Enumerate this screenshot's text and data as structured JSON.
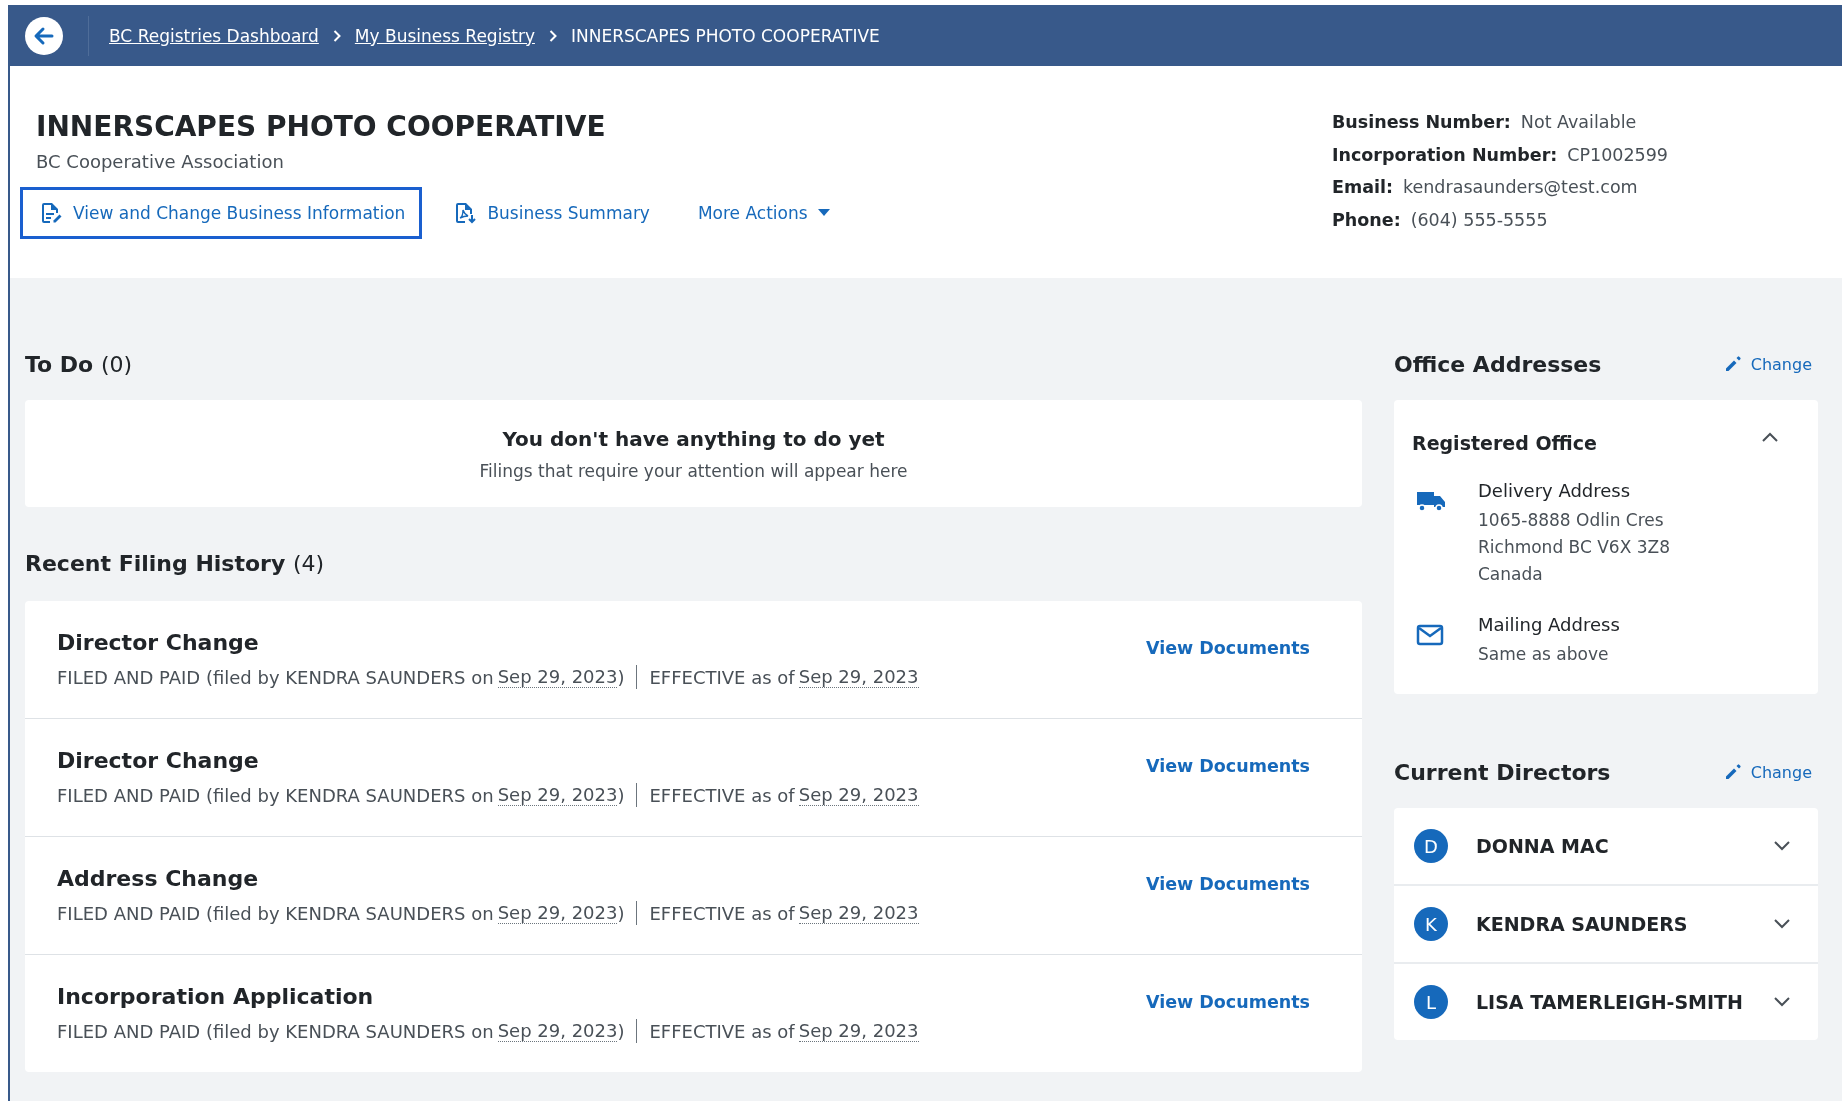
{
  "breadcrumb": [
    {
      "label": "BC Registries Dashboard",
      "kind": "link"
    },
    {
      "label": "My Business Registry",
      "kind": "link"
    },
    {
      "label": "INNERSCAPES PHOTO COOPERATIVE",
      "kind": "current"
    }
  ],
  "business": {
    "name": "INNERSCAPES PHOTO COOPERATIVE",
    "type": "BC Cooperative Association",
    "actions": [
      {
        "label": "View and Change Business Information",
        "kind": "edit",
        "focused": true
      },
      {
        "label": "Business Summary",
        "kind": "pdf",
        "focused": false
      },
      {
        "label": "More Actions",
        "kind": "menu",
        "focused": false
      }
    ],
    "details": [
      {
        "label": "Business Number:",
        "value": "Not Available"
      },
      {
        "label": "Incorporation Number:",
        "value": "CP1002599"
      },
      {
        "label": "Email:",
        "value": "kendrasaunders@test.com"
      },
      {
        "label": "Phone:",
        "value": "(604) 555-5555"
      }
    ]
  },
  "todo": {
    "title": "To Do",
    "count": "(0)",
    "empty_title": "You don't have anything to do yet",
    "empty_text": "Filings that require your attention will appear here"
  },
  "filing_history": {
    "title": "Recent Filing History",
    "count": "(4)",
    "items": [
      {
        "title": "Director Change",
        "status": "FILED AND PAID (filed by KENDRA SAUNDERS on",
        "filed_date": "Sep 29, 2023",
        "close": ")",
        "effective": "EFFECTIVE as of",
        "effective_date": "Sep 29, 2023",
        "action": "View Documents"
      },
      {
        "title": "Director Change",
        "status": "FILED AND PAID (filed by KENDRA SAUNDERS on",
        "filed_date": "Sep 29, 2023",
        "close": ")",
        "effective": "EFFECTIVE as of",
        "effective_date": "Sep 29, 2023",
        "action": "View Documents"
      },
      {
        "title": "Address Change",
        "status": "FILED AND PAID (filed by KENDRA SAUNDERS on",
        "filed_date": "Sep 29, 2023",
        "close": ")",
        "effective": "EFFECTIVE as of",
        "effective_date": "Sep 29, 2023",
        "action": "View Documents"
      },
      {
        "title": "Incorporation Application",
        "status": "FILED AND PAID (filed by KENDRA SAUNDERS on",
        "filed_date": "Sep 29, 2023",
        "close": ")",
        "effective": "EFFECTIVE as of",
        "effective_date": "Sep 29, 2023",
        "action": "View Documents"
      }
    ]
  },
  "office_addresses": {
    "title": "Office Addresses",
    "change": "Change",
    "office": {
      "title": "Registered Office",
      "expanded": true,
      "addresses": [
        {
          "kind": "delivery",
          "label": "Delivery Address",
          "lines": [
            "1065-8888 Odlin Cres",
            "Richmond BC V6X 3Z8",
            "Canada"
          ]
        },
        {
          "kind": "mailing",
          "label": "Mailing Address",
          "lines": [
            "Same as above"
          ]
        }
      ]
    }
  },
  "directors": {
    "title": "Current Directors",
    "change": "Change",
    "items": [
      {
        "initial": "D",
        "name": "DONNA MAC",
        "expanded": false
      },
      {
        "initial": "K",
        "name": "KENDRA SAUNDERS",
        "expanded": false
      },
      {
        "initial": "L",
        "name": "LISA TAMERLEIGH-SMITH",
        "expanded": false
      }
    ]
  }
}
